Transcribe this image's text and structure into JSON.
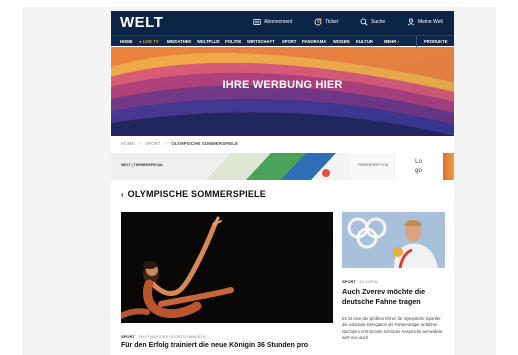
{
  "header": {
    "logo": "WELT",
    "abonnement": "Abonnement",
    "ticker": "Ticker",
    "suche": "Suche",
    "meine_welt": "Meine Welt"
  },
  "nav": {
    "items": [
      "HOME",
      "LIVE TV",
      "MEDIATHEK",
      "WELTPLUS",
      "POLITIK",
      "WIRTSCHAFT",
      "SPORT",
      "PANORAMA",
      "WISSEN",
      "KULTUR",
      "MEHR"
    ],
    "produkte": "PRODUKTE",
    "live_color": "#f0a23a"
  },
  "ad": {
    "text": "IHRE WERBUNG HIER"
  },
  "breadcrumb": {
    "items": [
      "HOME",
      "SPORT"
    ],
    "current": "OLYMPISCHE SOMMERSPIELE",
    "separator": ">"
  },
  "sponsor": {
    "left_text": "WELT | THEMENSPECIAL",
    "right_text": "PRÄSENTIERT VON",
    "logo_text": "Lo go"
  },
  "section": {
    "title": "OLYMPISCHE SOMMERSPIELE"
  },
  "main_article": {
    "tag_primary": "SPORT",
    "tag_secondary": "RHYTHMISCHE SPORTGYMNASTIK",
    "headline": "Für den Erfolg trainiert die neue Königin 36 Stunden pro"
  },
  "side_article": {
    "tag_primary": "SPORT",
    "tag_secondary": "OLYMPIA",
    "headline": "Auch Zverev möchte die deutsche Fahne tragen",
    "text": "Es ist eine der größten Ehren für olympische Sportler: die nationale Delegation als Fahnenträger anführen. Nachdem erst Dennis Schröder Ansprüche anmeldete, wirft nun auch"
  },
  "colors": {
    "brand_navy": "#0c2547",
    "accent_orange": "#f0a23a"
  }
}
